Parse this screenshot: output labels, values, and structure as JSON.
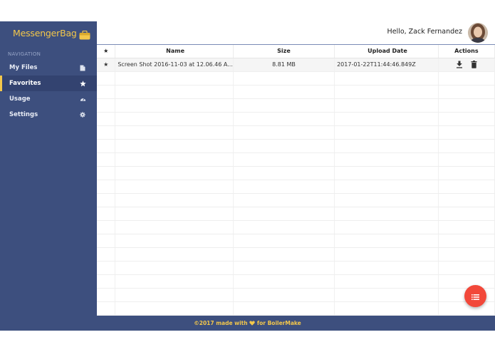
{
  "app": {
    "brand": "MessengerBag",
    "greeting": "Hello, Zack Fernandez"
  },
  "sidebar": {
    "heading": "NAVIGATION",
    "items": [
      {
        "label": "My Files",
        "icon": "file-icon"
      },
      {
        "label": "Favorites",
        "icon": "star-icon",
        "active": true
      },
      {
        "label": "Usage",
        "icon": "dashboard-icon"
      },
      {
        "label": "Settings",
        "icon": "gear-icon"
      }
    ]
  },
  "table": {
    "headers": {
      "star": "★",
      "name": "Name",
      "size": "Size",
      "date": "Upload Date",
      "actions": "Actions"
    },
    "rows": [
      {
        "star": "★",
        "name": "Screen Shot 2016-11-03 at 12.06.46 A...",
        "size": "8.81 MB",
        "date": "2017-01-22T11:44:46.849Z",
        "actions": [
          "download-icon",
          "trash-icon"
        ]
      }
    ]
  },
  "fab": {
    "icon": "list-icon"
  },
  "footer": {
    "prefix": "©2017 made with",
    "icon": "heart-icon",
    "suffix": "for BoilerMake"
  },
  "colors": {
    "sidebar": "#3d4f7e",
    "accent": "#f3c74b",
    "fab": "#f2483a"
  }
}
